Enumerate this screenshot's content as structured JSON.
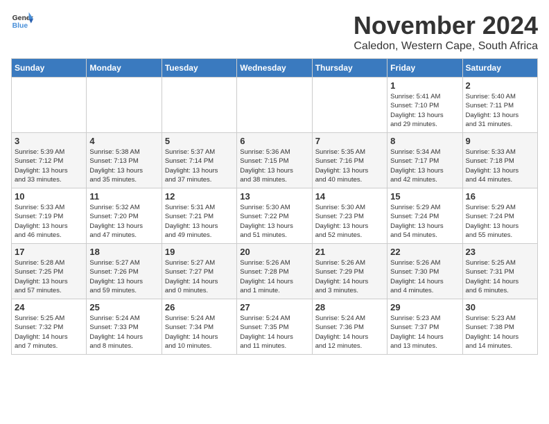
{
  "logo": {
    "line1": "General",
    "line2": "Blue"
  },
  "title": "November 2024",
  "location": "Caledon, Western Cape, South Africa",
  "weekdays": [
    "Sunday",
    "Monday",
    "Tuesday",
    "Wednesday",
    "Thursday",
    "Friday",
    "Saturday"
  ],
  "weeks": [
    [
      {
        "day": "",
        "info": ""
      },
      {
        "day": "",
        "info": ""
      },
      {
        "day": "",
        "info": ""
      },
      {
        "day": "",
        "info": ""
      },
      {
        "day": "",
        "info": ""
      },
      {
        "day": "1",
        "info": "Sunrise: 5:41 AM\nSunset: 7:10 PM\nDaylight: 13 hours\nand 29 minutes."
      },
      {
        "day": "2",
        "info": "Sunrise: 5:40 AM\nSunset: 7:11 PM\nDaylight: 13 hours\nand 31 minutes."
      }
    ],
    [
      {
        "day": "3",
        "info": "Sunrise: 5:39 AM\nSunset: 7:12 PM\nDaylight: 13 hours\nand 33 minutes."
      },
      {
        "day": "4",
        "info": "Sunrise: 5:38 AM\nSunset: 7:13 PM\nDaylight: 13 hours\nand 35 minutes."
      },
      {
        "day": "5",
        "info": "Sunrise: 5:37 AM\nSunset: 7:14 PM\nDaylight: 13 hours\nand 37 minutes."
      },
      {
        "day": "6",
        "info": "Sunrise: 5:36 AM\nSunset: 7:15 PM\nDaylight: 13 hours\nand 38 minutes."
      },
      {
        "day": "7",
        "info": "Sunrise: 5:35 AM\nSunset: 7:16 PM\nDaylight: 13 hours\nand 40 minutes."
      },
      {
        "day": "8",
        "info": "Sunrise: 5:34 AM\nSunset: 7:17 PM\nDaylight: 13 hours\nand 42 minutes."
      },
      {
        "day": "9",
        "info": "Sunrise: 5:33 AM\nSunset: 7:18 PM\nDaylight: 13 hours\nand 44 minutes."
      }
    ],
    [
      {
        "day": "10",
        "info": "Sunrise: 5:33 AM\nSunset: 7:19 PM\nDaylight: 13 hours\nand 46 minutes."
      },
      {
        "day": "11",
        "info": "Sunrise: 5:32 AM\nSunset: 7:20 PM\nDaylight: 13 hours\nand 47 minutes."
      },
      {
        "day": "12",
        "info": "Sunrise: 5:31 AM\nSunset: 7:21 PM\nDaylight: 13 hours\nand 49 minutes."
      },
      {
        "day": "13",
        "info": "Sunrise: 5:30 AM\nSunset: 7:22 PM\nDaylight: 13 hours\nand 51 minutes."
      },
      {
        "day": "14",
        "info": "Sunrise: 5:30 AM\nSunset: 7:23 PM\nDaylight: 13 hours\nand 52 minutes."
      },
      {
        "day": "15",
        "info": "Sunrise: 5:29 AM\nSunset: 7:24 PM\nDaylight: 13 hours\nand 54 minutes."
      },
      {
        "day": "16",
        "info": "Sunrise: 5:29 AM\nSunset: 7:24 PM\nDaylight: 13 hours\nand 55 minutes."
      }
    ],
    [
      {
        "day": "17",
        "info": "Sunrise: 5:28 AM\nSunset: 7:25 PM\nDaylight: 13 hours\nand 57 minutes."
      },
      {
        "day": "18",
        "info": "Sunrise: 5:27 AM\nSunset: 7:26 PM\nDaylight: 13 hours\nand 59 minutes."
      },
      {
        "day": "19",
        "info": "Sunrise: 5:27 AM\nSunset: 7:27 PM\nDaylight: 14 hours\nand 0 minutes."
      },
      {
        "day": "20",
        "info": "Sunrise: 5:26 AM\nSunset: 7:28 PM\nDaylight: 14 hours\nand 1 minute."
      },
      {
        "day": "21",
        "info": "Sunrise: 5:26 AM\nSunset: 7:29 PM\nDaylight: 14 hours\nand 3 minutes."
      },
      {
        "day": "22",
        "info": "Sunrise: 5:26 AM\nSunset: 7:30 PM\nDaylight: 14 hours\nand 4 minutes."
      },
      {
        "day": "23",
        "info": "Sunrise: 5:25 AM\nSunset: 7:31 PM\nDaylight: 14 hours\nand 6 minutes."
      }
    ],
    [
      {
        "day": "24",
        "info": "Sunrise: 5:25 AM\nSunset: 7:32 PM\nDaylight: 14 hours\nand 7 minutes."
      },
      {
        "day": "25",
        "info": "Sunrise: 5:24 AM\nSunset: 7:33 PM\nDaylight: 14 hours\nand 8 minutes."
      },
      {
        "day": "26",
        "info": "Sunrise: 5:24 AM\nSunset: 7:34 PM\nDaylight: 14 hours\nand 10 minutes."
      },
      {
        "day": "27",
        "info": "Sunrise: 5:24 AM\nSunset: 7:35 PM\nDaylight: 14 hours\nand 11 minutes."
      },
      {
        "day": "28",
        "info": "Sunrise: 5:24 AM\nSunset: 7:36 PM\nDaylight: 14 hours\nand 12 minutes."
      },
      {
        "day": "29",
        "info": "Sunrise: 5:23 AM\nSunset: 7:37 PM\nDaylight: 14 hours\nand 13 minutes."
      },
      {
        "day": "30",
        "info": "Sunrise: 5:23 AM\nSunset: 7:38 PM\nDaylight: 14 hours\nand 14 minutes."
      }
    ]
  ]
}
